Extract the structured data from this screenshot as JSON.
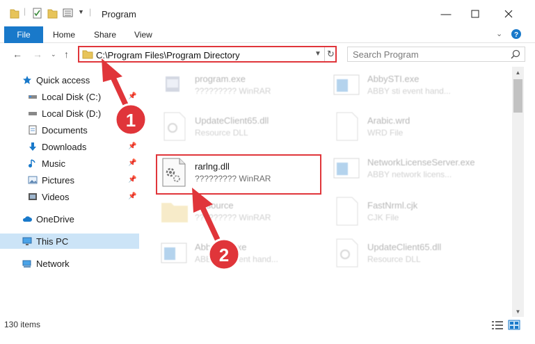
{
  "window": {
    "title": "Program"
  },
  "ribbon": {
    "tabs": [
      "File",
      "Home",
      "Share",
      "View"
    ]
  },
  "address": {
    "path": "C:\\Program Files\\Program Directory"
  },
  "search": {
    "placeholder": "Search Program"
  },
  "sidebar": {
    "items": [
      {
        "label": "Quick access",
        "icon": "star-icon"
      },
      {
        "label": "Local Disk (C:)",
        "icon": "drive-icon"
      },
      {
        "label": "Local Disk (D:)",
        "icon": "drive-icon"
      },
      {
        "label": "Documents",
        "icon": "documents-icon"
      },
      {
        "label": "Downloads",
        "icon": "download-icon"
      },
      {
        "label": "Music",
        "icon": "music-icon"
      },
      {
        "label": "Pictures",
        "icon": "pictures-icon"
      },
      {
        "label": "Videos",
        "icon": "videos-icon"
      },
      {
        "label": "OneDrive",
        "icon": "cloud-icon"
      },
      {
        "label": "This PC",
        "icon": "computer-icon"
      },
      {
        "label": "Network",
        "icon": "network-icon"
      }
    ]
  },
  "files": [
    {
      "name": "program.exe",
      "desc": "????????? WinRAR"
    },
    {
      "name": "AbbySTI.exe",
      "desc": "ABBY sti event hand..."
    },
    {
      "name": "UpdateClient65.dll",
      "desc": "Resource DLL"
    },
    {
      "name": "Arabic.wrd",
      "desc": "WRD File"
    },
    {
      "name": "rarlng.dll",
      "desc": "????????? WinRAR"
    },
    {
      "name": "NetworkLicenseServer.exe",
      "desc": "ABBY network licens..."
    },
    {
      "name": "Resource",
      "desc": "????????? WinRAR"
    },
    {
      "name": "FastNrml.cjk",
      "desc": "CJK File"
    },
    {
      "name": "AbbySTI.exe",
      "desc": "ABBY sti event hand..."
    },
    {
      "name": "UpdateClient65.dll",
      "desc": "Resource DLL"
    }
  ],
  "status": {
    "items_count": "130 items"
  },
  "annotations": {
    "step1": "1",
    "step2": "2",
    "color": "#e0353a"
  }
}
